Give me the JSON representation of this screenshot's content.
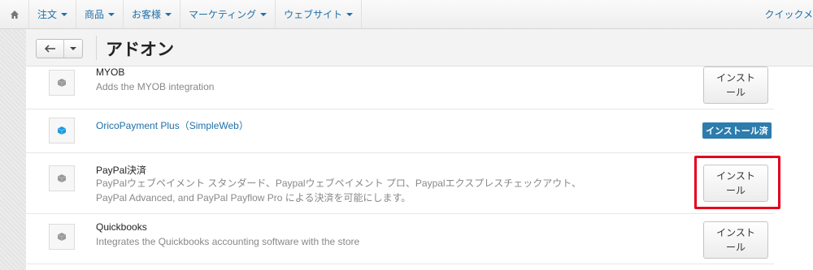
{
  "nav": {
    "items": [
      {
        "label": "注文"
      },
      {
        "label": "商品"
      },
      {
        "label": "お客様"
      },
      {
        "label": "マーケティング"
      },
      {
        "label": "ウェブサイト"
      }
    ],
    "quick_menu": "クイックメ"
  },
  "header": {
    "title": "アドオン"
  },
  "addons": [
    {
      "name": "MYOB",
      "desc1": "Adds the MYOB integration",
      "desc2": "",
      "action": "インスト\nール",
      "status": "not_installed",
      "icon": "cube-gray-icon"
    },
    {
      "name": "OricoPayment Plus（SimpleWeb）",
      "desc1": "",
      "desc2": "",
      "action": "インストール済",
      "status": "installed",
      "icon": "cube-blue-icon"
    },
    {
      "name": "PayPal決済",
      "desc1": "PayPalウェブペイメント スタンダード、Paypalウェブペイメント プロ、Paypalエクスプレスチェックアウト、",
      "desc2": "PayPal Advanced, and PayPal Payflow Pro による決済を可能にします。",
      "action": "インスト\nール",
      "status": "not_installed",
      "icon": "cube-gray-icon"
    },
    {
      "name": "Quickbooks",
      "desc1": "Integrates the Quickbooks accounting software with the store",
      "desc2": "",
      "action": "インスト\nール",
      "status": "not_installed",
      "icon": "cube-gray-icon"
    }
  ],
  "colors": {
    "link": "#1e6fa8",
    "badge": "#2c7cad",
    "highlight": "#e3001b"
  }
}
